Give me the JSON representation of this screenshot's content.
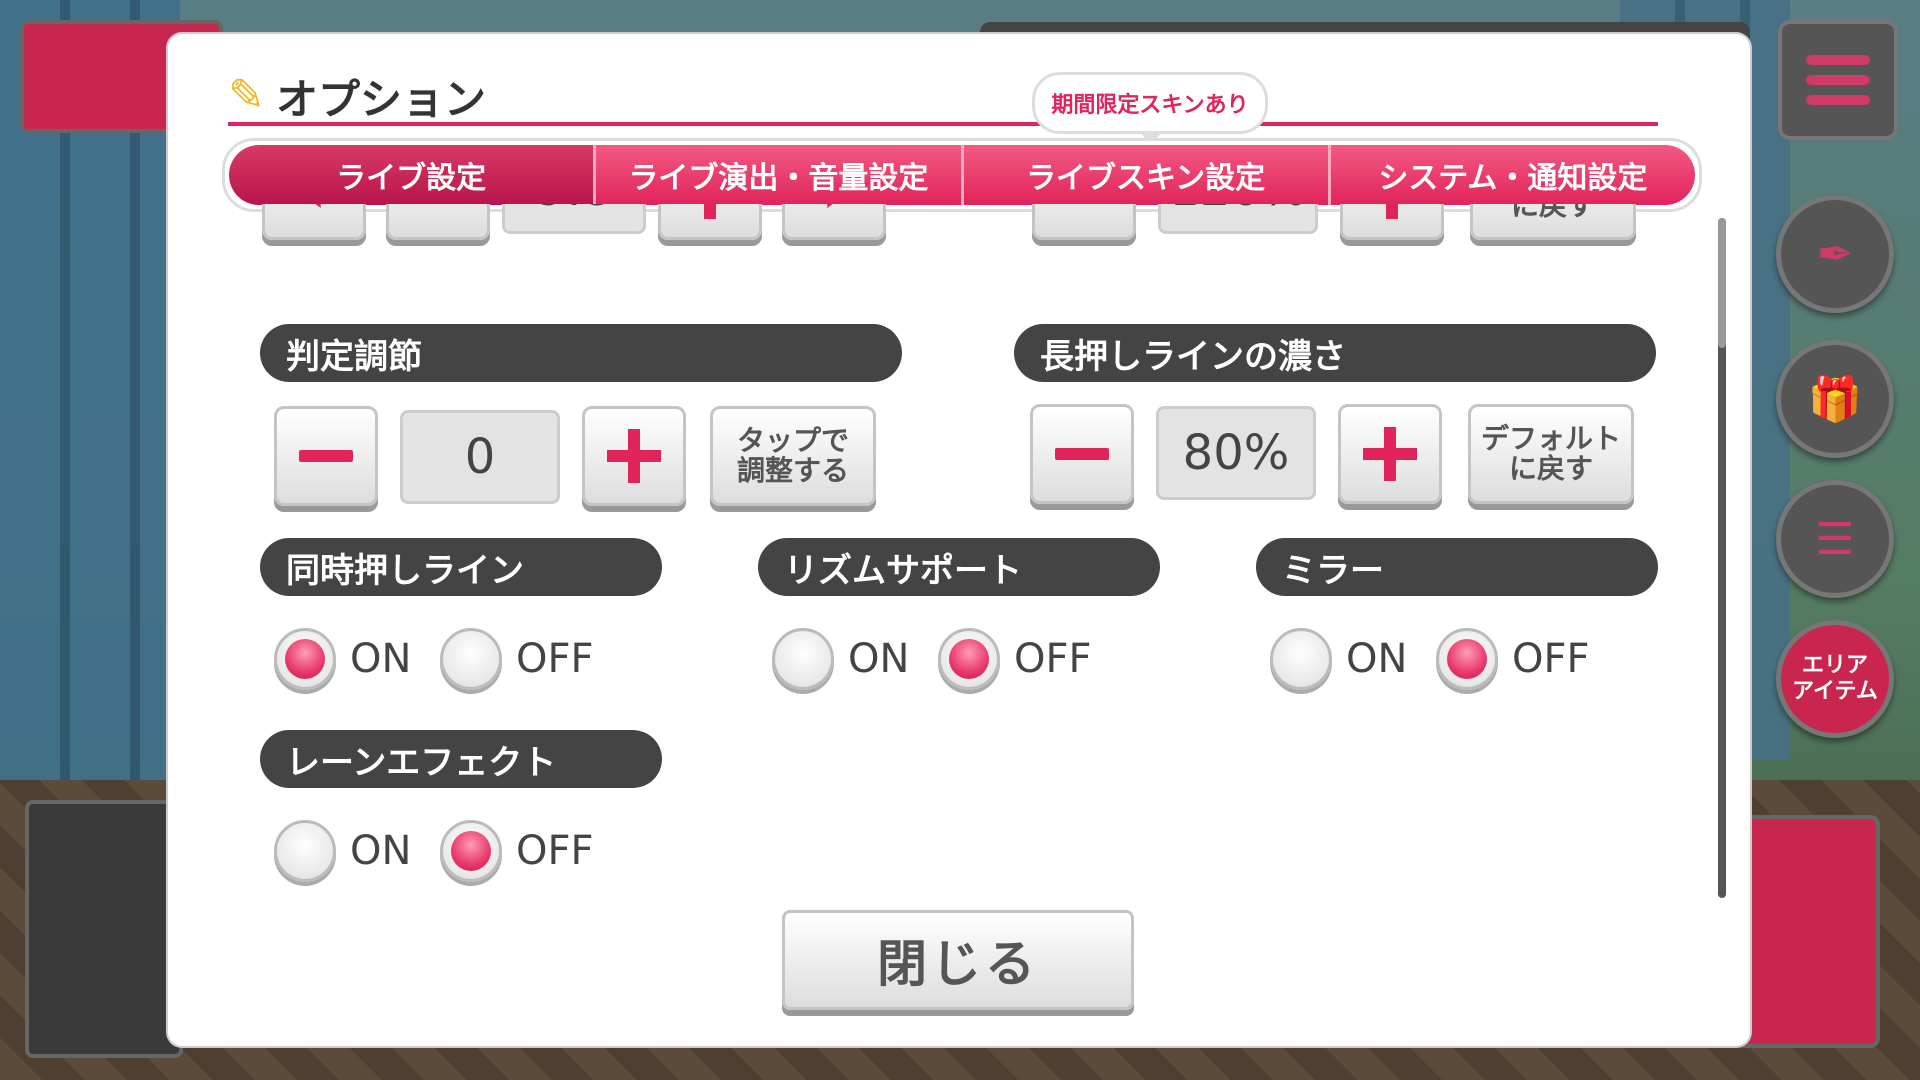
{
  "dialog": {
    "title": "オプション",
    "tooltip": "期間限定スキンあり",
    "tabs": [
      "ライブ設定",
      "ライブ演出・音量設定",
      "ライブスキン設定",
      "システム・通知設定"
    ],
    "active_tab": "ライブ設定",
    "partial_row": {
      "left_value": "9.8",
      "right_value": "120%",
      "right_reset": "に戻す"
    },
    "judgment": {
      "label": "判定調節",
      "value": "0",
      "tap_button": [
        "タップで",
        "調整する"
      ]
    },
    "hold_line": {
      "label": "長押しラインの濃さ",
      "value": "80%",
      "reset_button": [
        "デフォルト",
        "に戻す"
      ]
    },
    "simultaneous": {
      "label": "同時押しライン",
      "on": "ON",
      "off": "OFF",
      "selected": "ON"
    },
    "rhythm_support": {
      "label": "リズムサポート",
      "on": "ON",
      "off": "OFF",
      "selected": "OFF"
    },
    "mirror": {
      "label": "ミラー",
      "on": "ON",
      "off": "OFF",
      "selected": "OFF"
    },
    "lane_effect": {
      "label": "レーンエフェクト",
      "on": "ON",
      "off": "OFF",
      "selected": "OFF"
    },
    "close": "閉じる"
  },
  "background": {
    "area_item": [
      "エリア",
      "アイテム"
    ],
    "accent_color": "#e0245c"
  }
}
